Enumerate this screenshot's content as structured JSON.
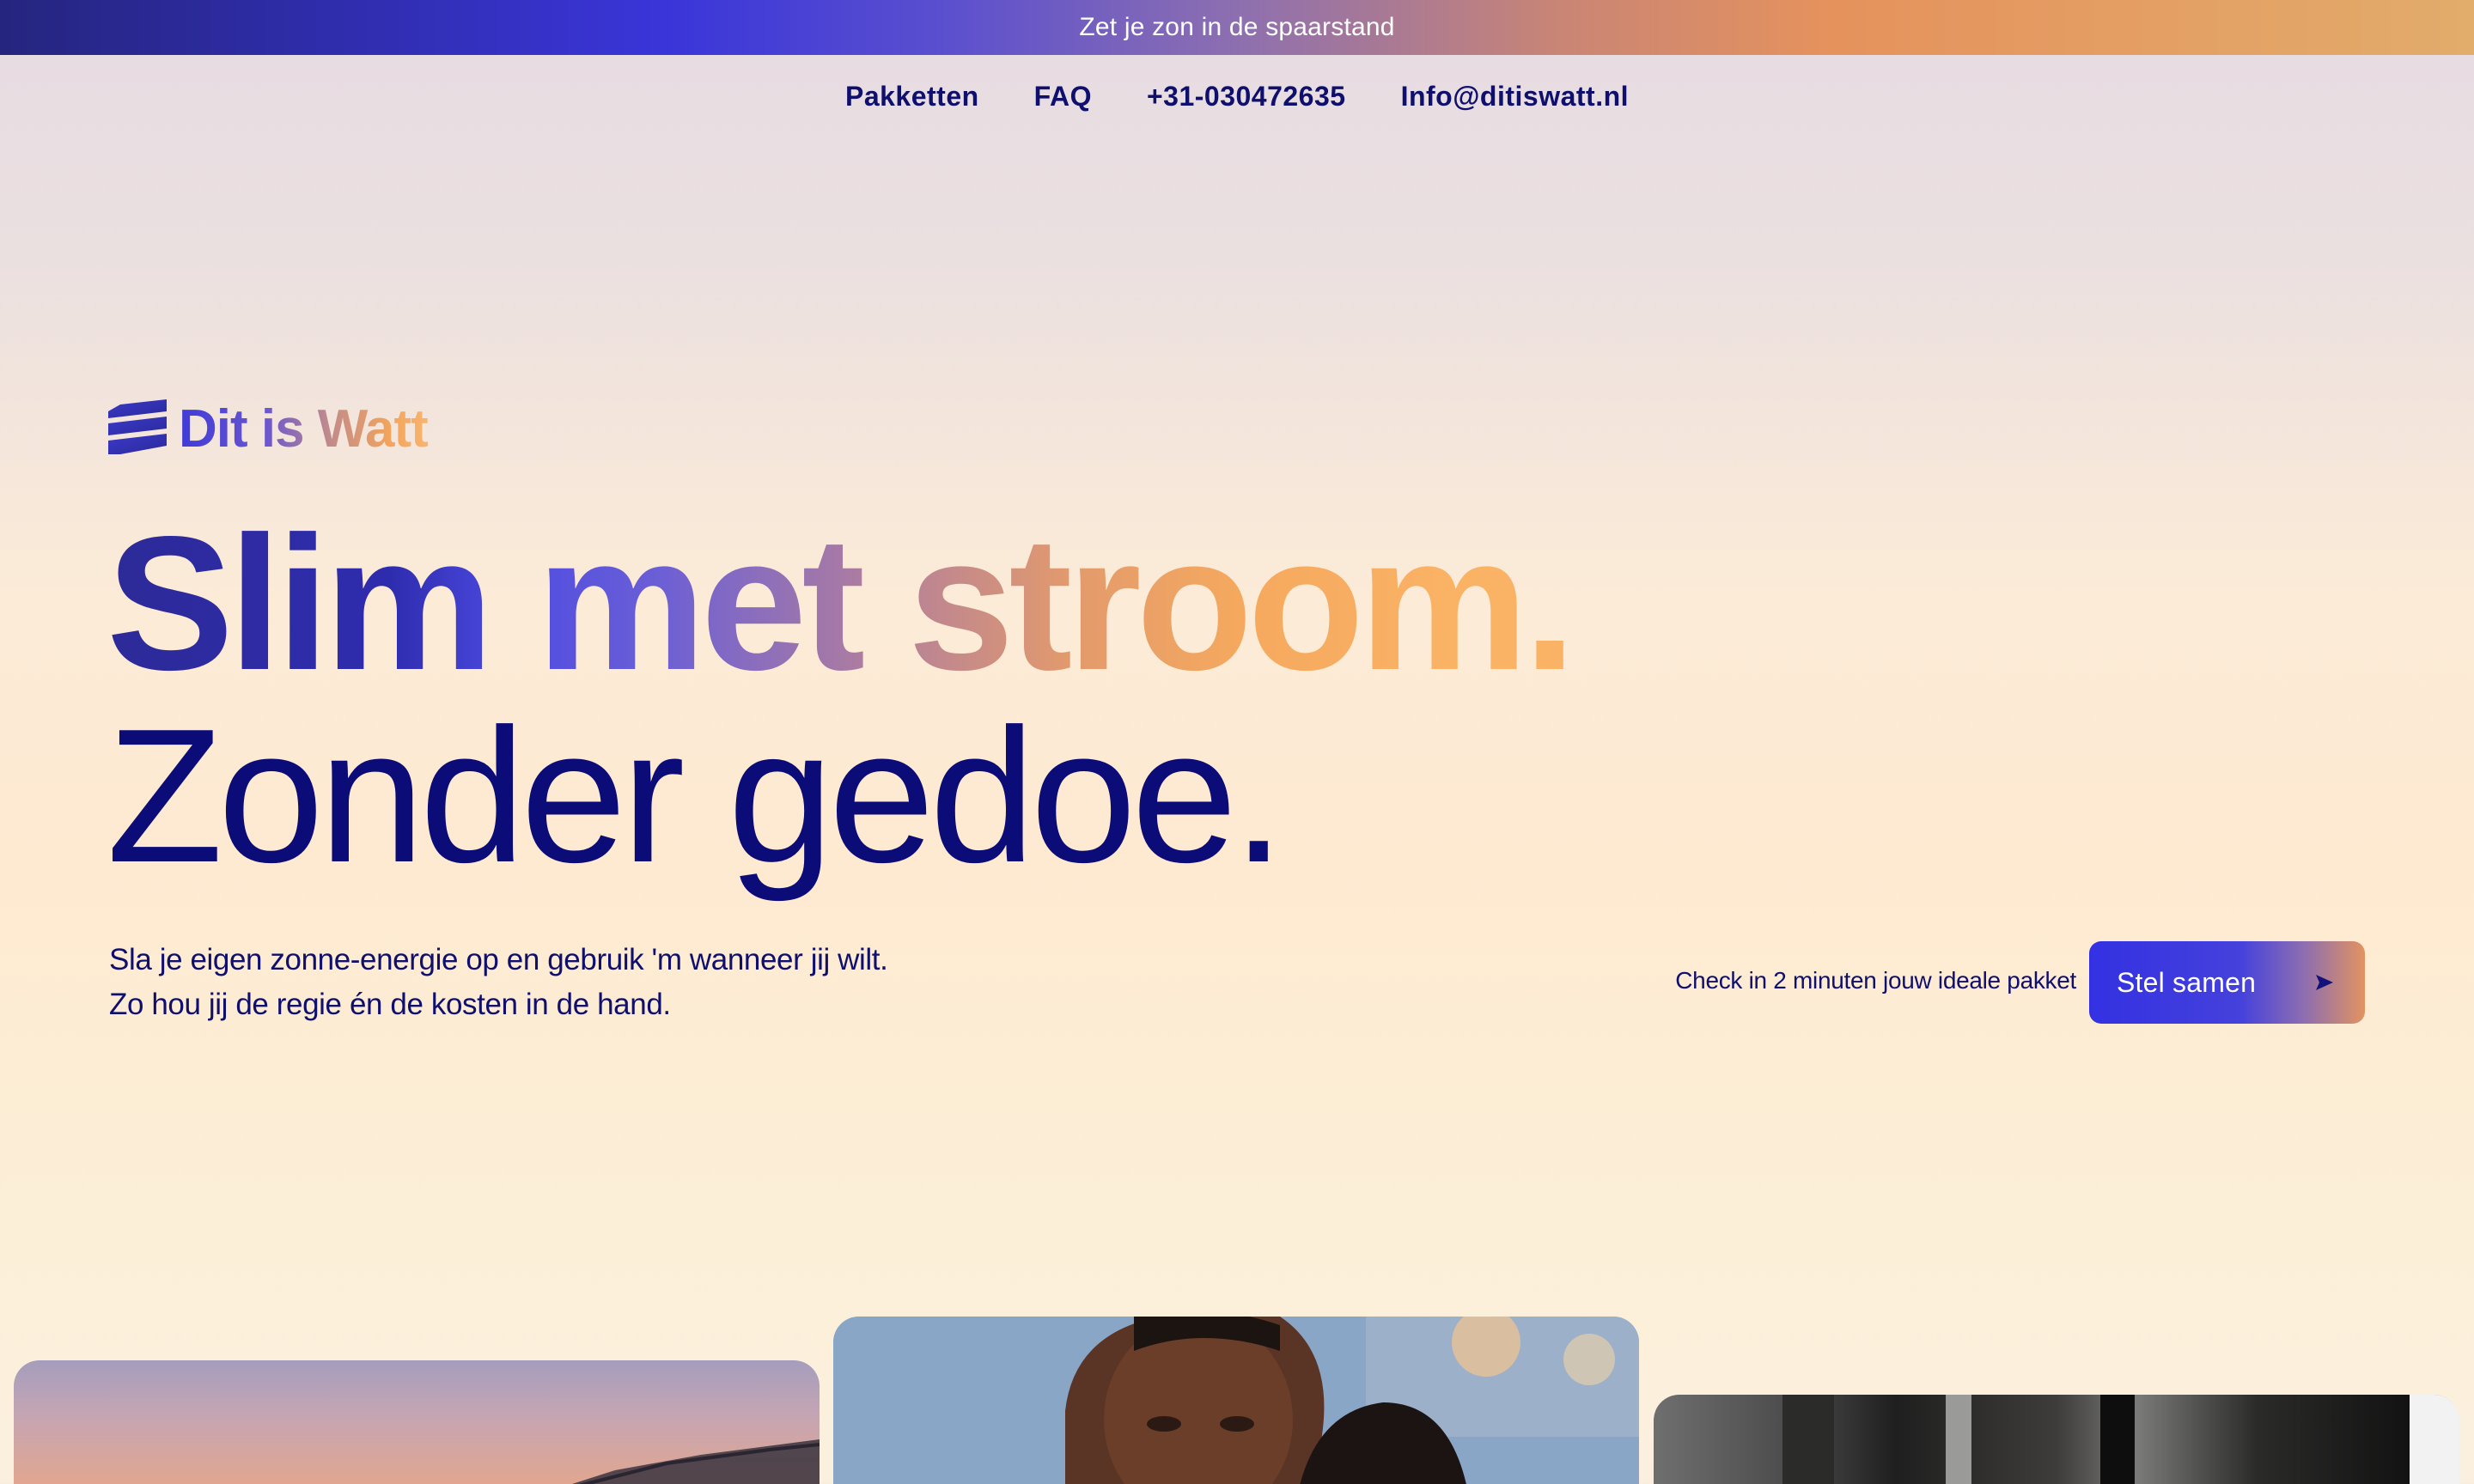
{
  "announcement": {
    "text": "Zet je zon in de spaarstand"
  },
  "nav": {
    "items": [
      {
        "label": "Pakketten"
      },
      {
        "label": "FAQ"
      },
      {
        "label": "+31-030472635"
      },
      {
        "label": "Info@ditiswatt.nl"
      }
    ]
  },
  "brand": {
    "name": "Dit is Watt",
    "logo_icon": "stacked-bars-logo-icon"
  },
  "hero": {
    "headline_line1": "Slim met stroom.",
    "headline_line2": "Zonder gedoe.",
    "subtext_line1": "Sla je eigen zonne-energie op en gebruik 'm wanneer jij wilt.",
    "subtext_line2": "Zo hou jij de regie én de kosten in de hand."
  },
  "cta": {
    "hint": "Check in 2 minuten jouw ideale pakket",
    "button_label": "Stel samen",
    "button_icon": "arrow-right-icon"
  },
  "gallery": {
    "cards": [
      {
        "description": "roof-solar-sunset-photo"
      },
      {
        "description": "couple-portrait-photo"
      },
      {
        "description": "interior-door-photo"
      }
    ]
  },
  "colors": {
    "navy": "#0f0f6e",
    "indigo": "#3331e2",
    "orange": "#f5a95e"
  }
}
